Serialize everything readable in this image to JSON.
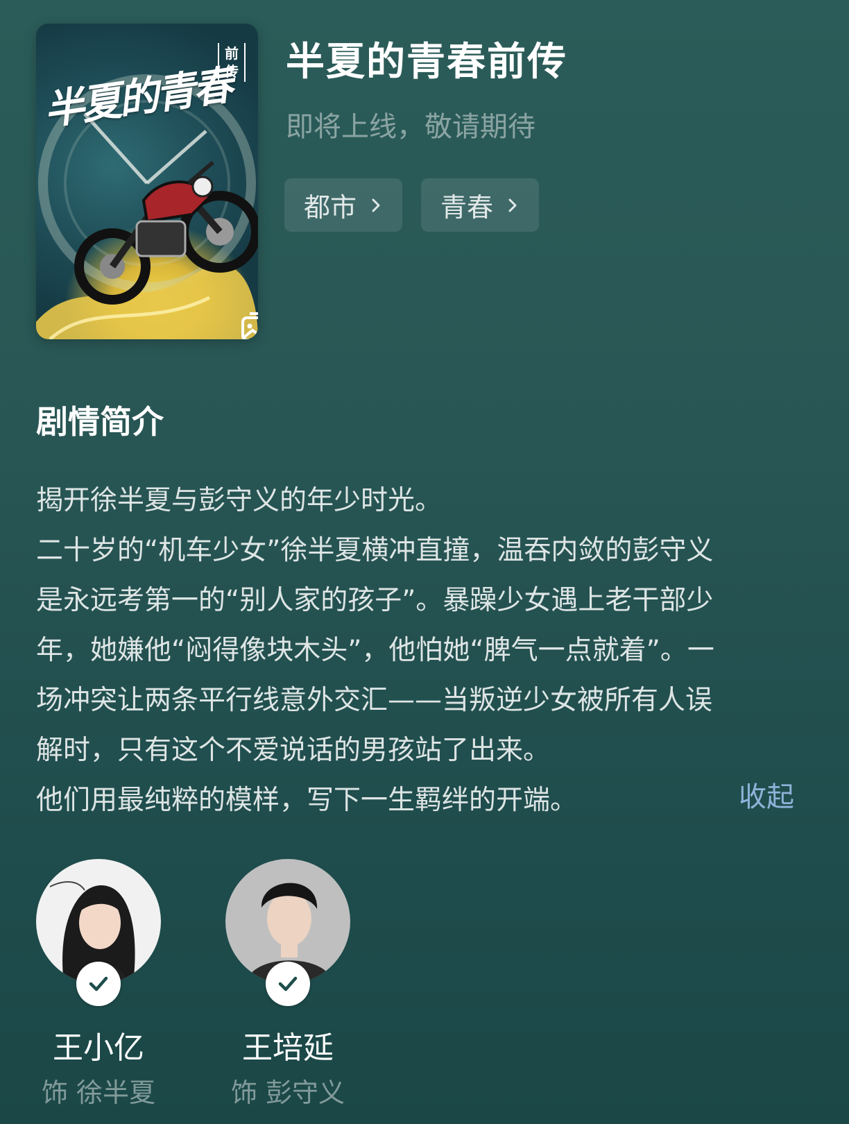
{
  "poster": {
    "title_art": "半夏的青春",
    "tag_art": "前传",
    "gallery_icon": "gallery-icon"
  },
  "header": {
    "title": "半夏的青春前传",
    "subtitle": "即将上线，敬请期待",
    "tags": [
      {
        "label": "都市",
        "icon": "chevron-right-icon"
      },
      {
        "label": "青春",
        "icon": "chevron-right-icon"
      }
    ]
  },
  "synopsis": {
    "heading": "剧情简介",
    "lines": [
      "揭开徐半夏与彭守义的年少时光。",
      "二十岁的“机车少女”徐半夏横冲直撞，温吞内敛的彭守义",
      "是永远考第一的“别人家的孩子”。暴躁少女遇上老干部少",
      "年，她嫌他“闷得像块木头”，他怕她“脾气一点就着”。一",
      "场冲突让两条平行线意外交汇——当叛逆少女被所有人误",
      "解时，只有这个不爱说话的男孩站了出来。",
      "他们用最纯粹的模样，写下一生羁绊的开端。"
    ],
    "collapse_label": "收起"
  },
  "cast": [
    {
      "name": "王小亿",
      "role": "饰 徐半夏",
      "badge_icon": "check-icon"
    },
    {
      "name": "王培延",
      "role": "饰 彭守义",
      "badge_icon": "check-icon"
    }
  ],
  "colors": {
    "background": "#285654",
    "link": "#8fb3d9"
  }
}
